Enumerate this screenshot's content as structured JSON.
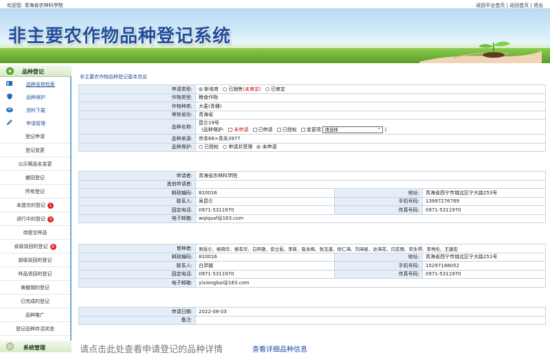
{
  "topbar": {
    "welcome": "欢迎您:  青海省农林科学院",
    "links": "返回平台首页 | 返回首页 | 退出"
  },
  "banner": {
    "title": "非主要农作物品种登记系统"
  },
  "sidebar": {
    "section1": "品种登记",
    "subs": [
      {
        "label": "品种名称检索",
        "icon": "search-book-icon"
      },
      {
        "label": "品种保护",
        "icon": "shield-icon"
      },
      {
        "label": "资料下载",
        "icon": "download-icon"
      },
      {
        "label": "申请管理",
        "icon": "pen-icon"
      }
    ],
    "items": [
      {
        "label": "登记申请",
        "badge": ""
      },
      {
        "label": "登记变更",
        "badge": ""
      },
      {
        "label": "公示期品名变更",
        "badge": ""
      },
      {
        "label": "撤回登记",
        "badge": ""
      },
      {
        "label": "所有登记",
        "badge": ""
      },
      {
        "label": "未提交的登记",
        "badge": "1"
      },
      {
        "label": "进行中的登记",
        "badge": "3"
      },
      {
        "label": "待提交样品",
        "badge": ""
      },
      {
        "label": "省级驳回的登记",
        "badge": "8"
      },
      {
        "label": "部级驳回的登记",
        "badge": ""
      },
      {
        "label": "样品退回的登记",
        "badge": ""
      },
      {
        "label": "被撤销的登记",
        "badge": ""
      },
      {
        "label": "已完成的登记",
        "badge": ""
      },
      {
        "label": "品种推广",
        "badge": ""
      },
      {
        "label": "登记品种存活状态",
        "badge": ""
      }
    ],
    "section2": "系统管理"
  },
  "main": {
    "section_title": "非主要农作物品种登记基本信息",
    "basic": {
      "apply_type_label": "申请类型:",
      "apply_type_opts": [
        "新培育",
        "已销售",
        "(未审定)",
        "已审定"
      ],
      "crop_type_label": "作物类型:",
      "crop_type": "粮食作物",
      "crop_species_label": "作物种类:",
      "crop_species": "大麦(青稞)",
      "province_label": "审核省份:",
      "province": "青海省",
      "variety_name_label": "品种名称:",
      "variety_name": "昆仑19号",
      "protect_prefix": "(品种保护:",
      "protect_opts": [
        "未申请",
        "已申请",
        "已授权",
        "变更项"
      ],
      "protect_select": "请选择",
      "protect_suffix": ")",
      "source_label": "品种来源:",
      "source": "宗本66×青永3977",
      "protection_label": "品种保护:",
      "protection_opts": [
        "已授权",
        "申请并受理",
        "未申请"
      ]
    },
    "applicant": {
      "applicant_label": "申请者:",
      "applicant": "青海省农林科学院",
      "other_label": "其他申请者:",
      "other": "",
      "postcode_label": "邮政编码:",
      "postcode": "810016",
      "address_label": "地址:",
      "address": "青海省西宁市城北区宁大路253号",
      "contact_label": "联系人:",
      "contact": "吴昆仑",
      "mobile_label": "手机号码:",
      "mobile": "13997276769",
      "phone_label": "固定电话:",
      "phone": "0971-5311970",
      "fax_label": "传真号码:",
      "fax": "0971-5311970",
      "email_label": "电子邮箱:",
      "email": "wqlqaaf@163.com"
    },
    "breeder": {
      "breeder_label": "育种者:",
      "breeder": "吴昆仑、姚晓华、姚有华、白羿雄、安立昆、李新、崔永梅、张玉道、徐仁海、刘海星、达海花、闫志丽、宋生得、李亮伦、王建宏",
      "postcode_label": "邮政编码:",
      "postcode": "810016",
      "address_label": "地址:",
      "address": "青海省西宁市城北区宁大路251号",
      "contact_label": "联系人:",
      "contact": "白羿雄",
      "mobile_label": "手机号码:",
      "mobile": "15297188052",
      "phone_label": "固定电话:",
      "phone": "0971-5311970",
      "fax_label": "传真号码:",
      "fax": "0971-5311970",
      "email_label": "电子邮箱:",
      "email": "yixiongbai@163.com"
    },
    "footer": {
      "date_label": "申请日期:",
      "date": "2022-08-03",
      "remark_label": "备注:",
      "remark": ""
    },
    "bottom_msg": "请点击此处查看申请登记的品种详情",
    "bottom_link": "查看详细品种信息"
  },
  "colors": {
    "label_bg": "#e5eef8",
    "border": "#c6d2e0",
    "link_blue": "#1f4e9b",
    "badge_red": "#e02424"
  }
}
